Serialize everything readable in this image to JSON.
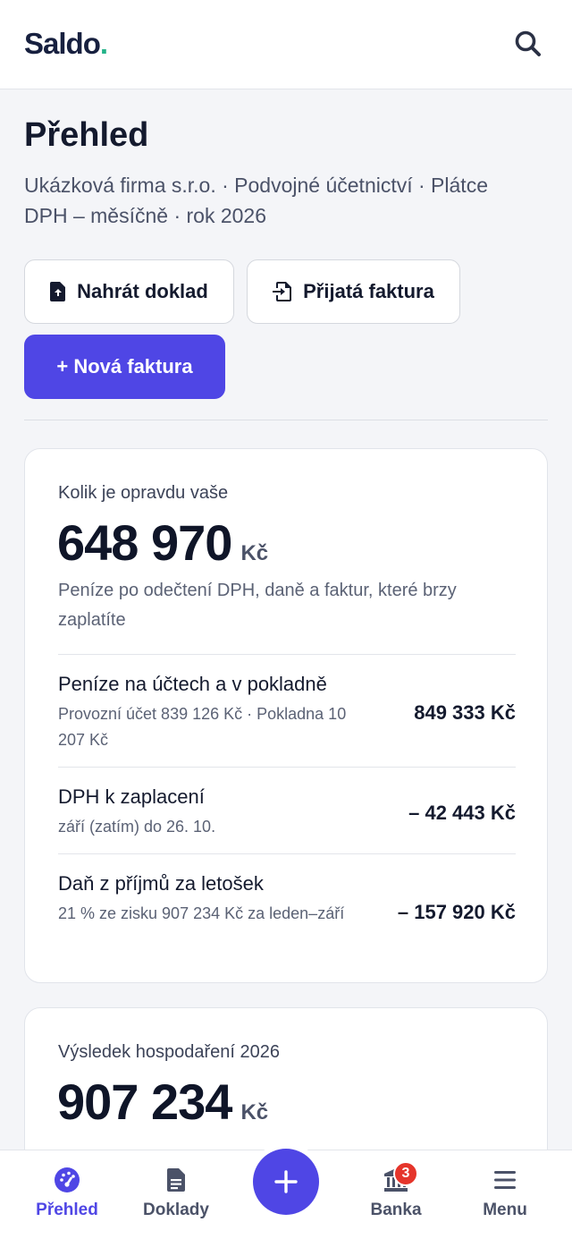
{
  "app": {
    "brand": "Saldo",
    "brand_dot": "."
  },
  "page": {
    "title": "Přehled",
    "subtitle": "Ukázková firma s.r.o. · Podvojné účetnictví · Plátce DPH – měsíčně · rok 2026"
  },
  "actions": {
    "upload_label": "Nahrát doklad",
    "received_invoice_label": "Přijatá faktura",
    "new_invoice_label": "+ Nová faktura"
  },
  "summary_card": {
    "label": "Kolik je opravdu vaše",
    "amount": "648 970",
    "currency": "Kč",
    "description": "Peníze po odečtení DPH, daně a faktur, které brzy zaplatíte",
    "rows": [
      {
        "title": "Peníze na účtech a v pokladně",
        "subtitle": "Provozní účet 839 126 Kč · Pokladna 10 207 Kč",
        "value": "849 333 Kč"
      },
      {
        "title": "DPH k zaplacení",
        "subtitle": "září (zatím) do 26. 10.",
        "value": "– 42 443 Kč"
      },
      {
        "title": "Daň z příjmů za letošek",
        "subtitle": "21 % ze zisku 907 234 Kč za leden–září",
        "value": "– 157 920 Kč"
      }
    ]
  },
  "result_card": {
    "label": "Výsledek hospodaření 2026",
    "amount": "907 234",
    "currency": "Kč"
  },
  "nav": {
    "items": [
      {
        "label": "Přehled",
        "icon": "gauge-icon",
        "active": true
      },
      {
        "label": "Doklady",
        "icon": "document-icon",
        "active": false
      },
      {
        "label": "Banka",
        "icon": "bank-icon",
        "active": false,
        "badge": "3"
      },
      {
        "label": "Menu",
        "icon": "hamburger-icon",
        "active": false
      }
    ],
    "fab_icon": "plus-icon"
  },
  "colors": {
    "accent": "#4f46e5",
    "brand_dot": "#23b389",
    "badge": "#e5352b",
    "text": "#141a2e"
  }
}
